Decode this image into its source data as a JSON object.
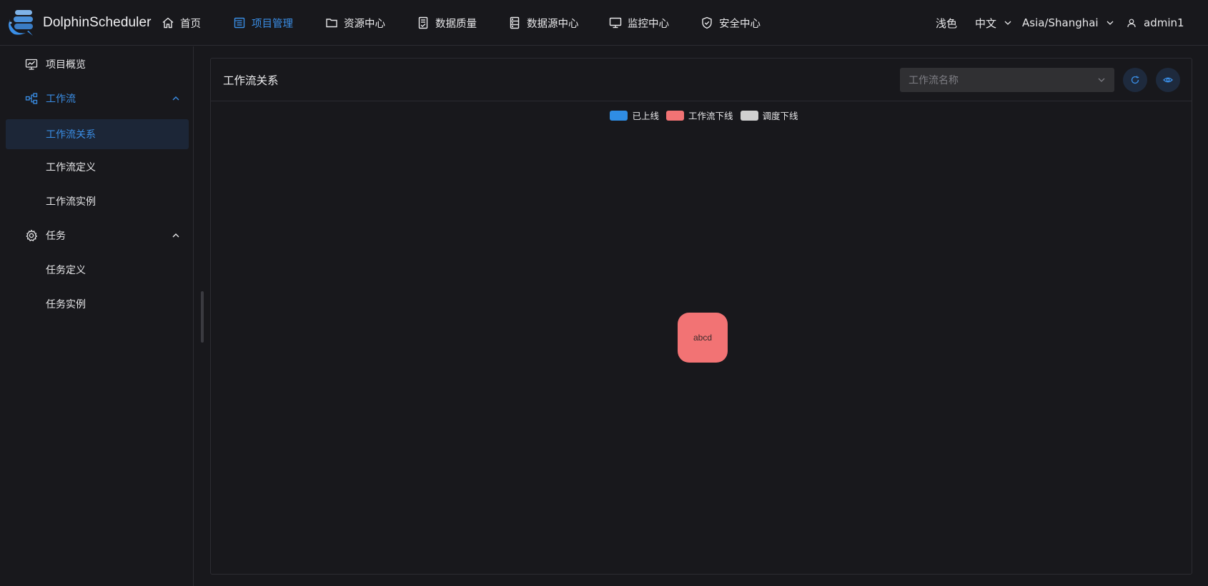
{
  "app": {
    "name": "DolphinScheduler"
  },
  "nav": [
    {
      "label": "首页",
      "icon": "home-icon",
      "active": false
    },
    {
      "label": "项目管理",
      "icon": "project-icon",
      "active": true
    },
    {
      "label": "资源中心",
      "icon": "folder-icon",
      "active": false
    },
    {
      "label": "数据质量",
      "icon": "data-quality-icon",
      "active": false
    },
    {
      "label": "数据源中心",
      "icon": "datasource-icon",
      "active": false
    },
    {
      "label": "监控中心",
      "icon": "monitor-icon",
      "active": false
    },
    {
      "label": "安全中心",
      "icon": "shield-icon",
      "active": false
    }
  ],
  "header_right": {
    "theme": "浅色",
    "language": "中文",
    "timezone": "Asia/Shanghai",
    "user": "admin1"
  },
  "sidebar": {
    "items": [
      {
        "label": "项目概览",
        "icon": "chart-icon",
        "type": "item"
      },
      {
        "label": "工作流",
        "icon": "workflow-icon",
        "type": "group",
        "expanded": true
      },
      {
        "label": "工作流关系",
        "type": "sub",
        "selected": true
      },
      {
        "label": "工作流定义",
        "type": "sub"
      },
      {
        "label": "工作流实例",
        "type": "sub"
      },
      {
        "label": "任务",
        "icon": "gear-icon",
        "type": "group",
        "expanded": true
      },
      {
        "label": "任务定义",
        "type": "sub"
      },
      {
        "label": "任务实例",
        "type": "sub"
      }
    ]
  },
  "main": {
    "title": "工作流关系",
    "select_placeholder": "工作流名称",
    "legend": [
      {
        "label": "已上线",
        "color": "#2f8de4"
      },
      {
        "label": "工作流下线",
        "color": "#f27374"
      },
      {
        "label": "调度下线",
        "color": "#d0d0d0"
      }
    ],
    "nodes": [
      {
        "label": "abcd",
        "status": "工作流下线",
        "color": "#f27374"
      }
    ]
  },
  "colors": {
    "accent": "#3a8ee6",
    "background": "#18181c",
    "border": "#2c2c32",
    "selected_bg": "#1c2637"
  }
}
